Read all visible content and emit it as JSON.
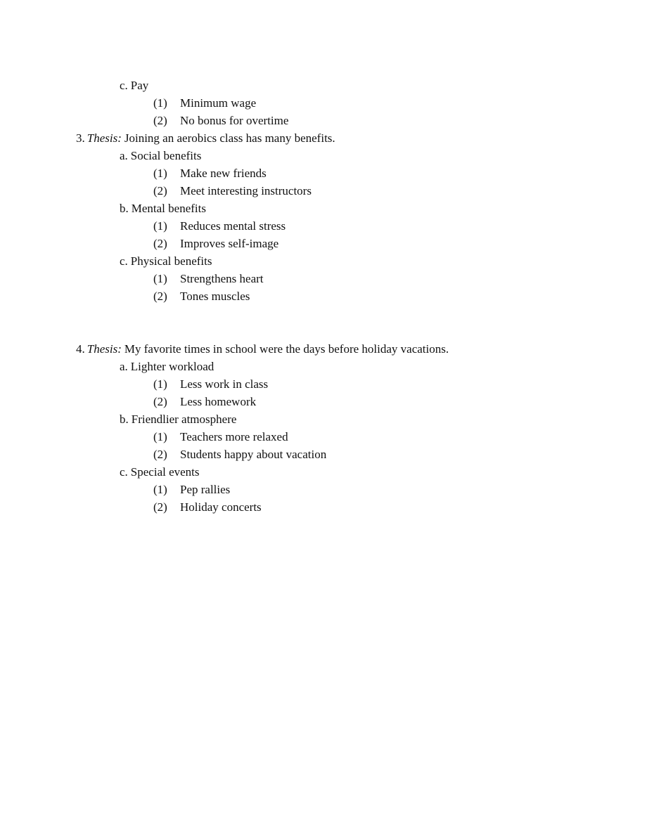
{
  "document": {
    "type": "outline-worksheet",
    "page_background": "#ffffff",
    "text_color": "#111111"
  },
  "blocks": [
    {
      "kind": "alpha",
      "marker": "c.",
      "text": "Pay"
    },
    {
      "kind": "paren",
      "marker": "(1)",
      "text": "Minimum wage"
    },
    {
      "kind": "paren",
      "marker": "(2)",
      "text": "No bonus for overtime"
    },
    {
      "kind": "thesis",
      "marker": "3.",
      "keyword": "Thesis:",
      "text": "Joining an aerobics class has many benefits."
    },
    {
      "kind": "alpha",
      "marker": "a.",
      "text": "Social benefits"
    },
    {
      "kind": "paren",
      "marker": "(1)",
      "text": "Make new friends"
    },
    {
      "kind": "paren",
      "marker": "(2)",
      "text": "Meet interesting instructors"
    },
    {
      "kind": "alpha",
      "marker": "b.",
      "text": "Mental benefits"
    },
    {
      "kind": "paren",
      "marker": "(1)",
      "text": "Reduces mental stress"
    },
    {
      "kind": "paren",
      "marker": "(2)",
      "text": "Improves self-image"
    },
    {
      "kind": "alpha",
      "marker": "c.",
      "text": "Physical benefits"
    },
    {
      "kind": "paren",
      "marker": "(1)",
      "text": "Strengthens heart"
    },
    {
      "kind": "paren",
      "marker": "(2)",
      "text": "Tones muscles"
    },
    {
      "kind": "spacer"
    },
    {
      "kind": "thesis",
      "marker": "4.",
      "keyword": "Thesis:",
      "text": "My favorite times in school were the days before holiday vacations."
    },
    {
      "kind": "alpha",
      "marker": "a.",
      "text": "Lighter workload"
    },
    {
      "kind": "paren",
      "marker": "(1)",
      "text": "Less work in class"
    },
    {
      "kind": "paren",
      "marker": "(2)",
      "text": "Less homework"
    },
    {
      "kind": "alpha",
      "marker": "b.",
      "text": "Friendlier atmosphere"
    },
    {
      "kind": "paren",
      "marker": "(1)",
      "text": "Teachers more relaxed"
    },
    {
      "kind": "paren",
      "marker": "(2)",
      "text": "Students happy about vacation"
    },
    {
      "kind": "alpha",
      "marker": "c.",
      "text": "Special events"
    },
    {
      "kind": "paren",
      "marker": "(1)",
      "text": "Pep rallies"
    },
    {
      "kind": "paren",
      "marker": "(2)",
      "text": "Holiday concerts"
    }
  ]
}
